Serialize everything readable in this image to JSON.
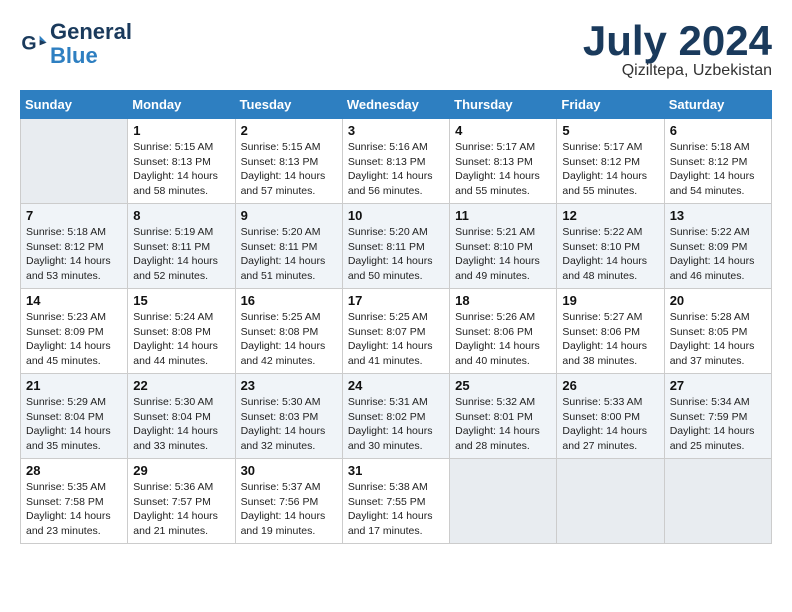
{
  "header": {
    "logo_line1": "General",
    "logo_line2": "Blue",
    "month": "July 2024",
    "location": "Qiziltepa, Uzbekistan"
  },
  "weekdays": [
    "Sunday",
    "Monday",
    "Tuesday",
    "Wednesday",
    "Thursday",
    "Friday",
    "Saturday"
  ],
  "weeks": [
    [
      {
        "day": "",
        "info": ""
      },
      {
        "day": "1",
        "info": "Sunrise: 5:15 AM\nSunset: 8:13 PM\nDaylight: 14 hours\nand 58 minutes."
      },
      {
        "day": "2",
        "info": "Sunrise: 5:15 AM\nSunset: 8:13 PM\nDaylight: 14 hours\nand 57 minutes."
      },
      {
        "day": "3",
        "info": "Sunrise: 5:16 AM\nSunset: 8:13 PM\nDaylight: 14 hours\nand 56 minutes."
      },
      {
        "day": "4",
        "info": "Sunrise: 5:17 AM\nSunset: 8:13 PM\nDaylight: 14 hours\nand 55 minutes."
      },
      {
        "day": "5",
        "info": "Sunrise: 5:17 AM\nSunset: 8:12 PM\nDaylight: 14 hours\nand 55 minutes."
      },
      {
        "day": "6",
        "info": "Sunrise: 5:18 AM\nSunset: 8:12 PM\nDaylight: 14 hours\nand 54 minutes."
      }
    ],
    [
      {
        "day": "7",
        "info": "Sunrise: 5:18 AM\nSunset: 8:12 PM\nDaylight: 14 hours\nand 53 minutes."
      },
      {
        "day": "8",
        "info": "Sunrise: 5:19 AM\nSunset: 8:11 PM\nDaylight: 14 hours\nand 52 minutes."
      },
      {
        "day": "9",
        "info": "Sunrise: 5:20 AM\nSunset: 8:11 PM\nDaylight: 14 hours\nand 51 minutes."
      },
      {
        "day": "10",
        "info": "Sunrise: 5:20 AM\nSunset: 8:11 PM\nDaylight: 14 hours\nand 50 minutes."
      },
      {
        "day": "11",
        "info": "Sunrise: 5:21 AM\nSunset: 8:10 PM\nDaylight: 14 hours\nand 49 minutes."
      },
      {
        "day": "12",
        "info": "Sunrise: 5:22 AM\nSunset: 8:10 PM\nDaylight: 14 hours\nand 48 minutes."
      },
      {
        "day": "13",
        "info": "Sunrise: 5:22 AM\nSunset: 8:09 PM\nDaylight: 14 hours\nand 46 minutes."
      }
    ],
    [
      {
        "day": "14",
        "info": "Sunrise: 5:23 AM\nSunset: 8:09 PM\nDaylight: 14 hours\nand 45 minutes."
      },
      {
        "day": "15",
        "info": "Sunrise: 5:24 AM\nSunset: 8:08 PM\nDaylight: 14 hours\nand 44 minutes."
      },
      {
        "day": "16",
        "info": "Sunrise: 5:25 AM\nSunset: 8:08 PM\nDaylight: 14 hours\nand 42 minutes."
      },
      {
        "day": "17",
        "info": "Sunrise: 5:25 AM\nSunset: 8:07 PM\nDaylight: 14 hours\nand 41 minutes."
      },
      {
        "day": "18",
        "info": "Sunrise: 5:26 AM\nSunset: 8:06 PM\nDaylight: 14 hours\nand 40 minutes."
      },
      {
        "day": "19",
        "info": "Sunrise: 5:27 AM\nSunset: 8:06 PM\nDaylight: 14 hours\nand 38 minutes."
      },
      {
        "day": "20",
        "info": "Sunrise: 5:28 AM\nSunset: 8:05 PM\nDaylight: 14 hours\nand 37 minutes."
      }
    ],
    [
      {
        "day": "21",
        "info": "Sunrise: 5:29 AM\nSunset: 8:04 PM\nDaylight: 14 hours\nand 35 minutes."
      },
      {
        "day": "22",
        "info": "Sunrise: 5:30 AM\nSunset: 8:04 PM\nDaylight: 14 hours\nand 33 minutes."
      },
      {
        "day": "23",
        "info": "Sunrise: 5:30 AM\nSunset: 8:03 PM\nDaylight: 14 hours\nand 32 minutes."
      },
      {
        "day": "24",
        "info": "Sunrise: 5:31 AM\nSunset: 8:02 PM\nDaylight: 14 hours\nand 30 minutes."
      },
      {
        "day": "25",
        "info": "Sunrise: 5:32 AM\nSunset: 8:01 PM\nDaylight: 14 hours\nand 28 minutes."
      },
      {
        "day": "26",
        "info": "Sunrise: 5:33 AM\nSunset: 8:00 PM\nDaylight: 14 hours\nand 27 minutes."
      },
      {
        "day": "27",
        "info": "Sunrise: 5:34 AM\nSunset: 7:59 PM\nDaylight: 14 hours\nand 25 minutes."
      }
    ],
    [
      {
        "day": "28",
        "info": "Sunrise: 5:35 AM\nSunset: 7:58 PM\nDaylight: 14 hours\nand 23 minutes."
      },
      {
        "day": "29",
        "info": "Sunrise: 5:36 AM\nSunset: 7:57 PM\nDaylight: 14 hours\nand 21 minutes."
      },
      {
        "day": "30",
        "info": "Sunrise: 5:37 AM\nSunset: 7:56 PM\nDaylight: 14 hours\nand 19 minutes."
      },
      {
        "day": "31",
        "info": "Sunrise: 5:38 AM\nSunset: 7:55 PM\nDaylight: 14 hours\nand 17 minutes."
      },
      {
        "day": "",
        "info": ""
      },
      {
        "day": "",
        "info": ""
      },
      {
        "day": "",
        "info": ""
      }
    ]
  ]
}
